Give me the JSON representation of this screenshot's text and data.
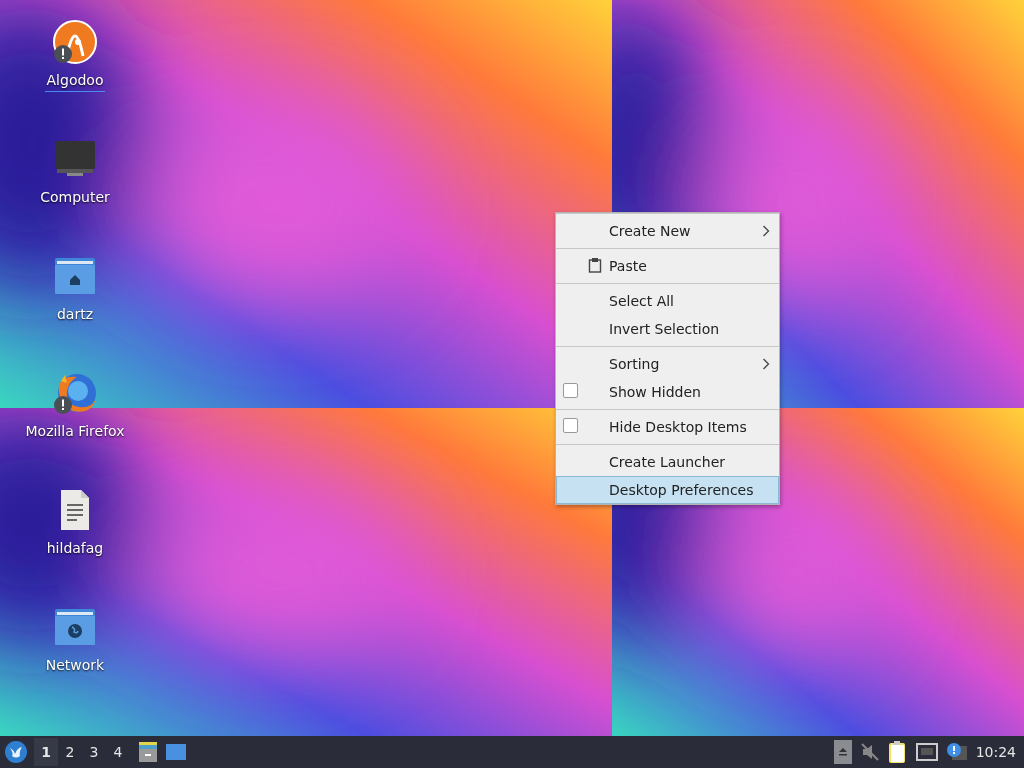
{
  "desktop_icons": [
    {
      "label": "Algodoo",
      "kind": "app",
      "warning": true,
      "selected": true
    },
    {
      "label": "Computer",
      "kind": "computer",
      "warning": false,
      "selected": false
    },
    {
      "label": "dartz",
      "kind": "home-folder",
      "warning": false,
      "selected": false
    },
    {
      "label": "Mozilla Firefox",
      "kind": "browser",
      "warning": true,
      "selected": false
    },
    {
      "label": "hildafag",
      "kind": "document",
      "warning": false,
      "selected": false
    },
    {
      "label": "Network",
      "kind": "network-folder",
      "warning": false,
      "selected": false
    }
  ],
  "context_menu": {
    "sections": [
      {
        "items": [
          {
            "label": "Create New",
            "kind": "submenu",
            "selected": false
          }
        ]
      },
      {
        "items": [
          {
            "label": "Paste",
            "kind": "clipboard",
            "selected": false
          }
        ]
      },
      {
        "items": [
          {
            "label": "Select All",
            "kind": "plain",
            "selected": false
          },
          {
            "label": "Invert Selection",
            "kind": "plain",
            "selected": false
          }
        ]
      },
      {
        "items": [
          {
            "label": "Sorting",
            "kind": "submenu",
            "selected": false
          },
          {
            "label": "Show Hidden",
            "kind": "check",
            "checked": false,
            "selected": false
          }
        ]
      },
      {
        "items": [
          {
            "label": "Hide Desktop Items",
            "kind": "check",
            "checked": false,
            "selected": false
          }
        ]
      },
      {
        "items": [
          {
            "label": "Create Launcher",
            "kind": "plain",
            "selected": false
          },
          {
            "label": "Desktop Preferences",
            "kind": "plain",
            "selected": true
          }
        ]
      }
    ]
  },
  "taskbar": {
    "workspaces": [
      {
        "label": "1",
        "selected": true
      },
      {
        "label": "2",
        "selected": false
      },
      {
        "label": "3",
        "selected": false
      },
      {
        "label": "4",
        "selected": false
      }
    ],
    "clock": "10:24"
  }
}
